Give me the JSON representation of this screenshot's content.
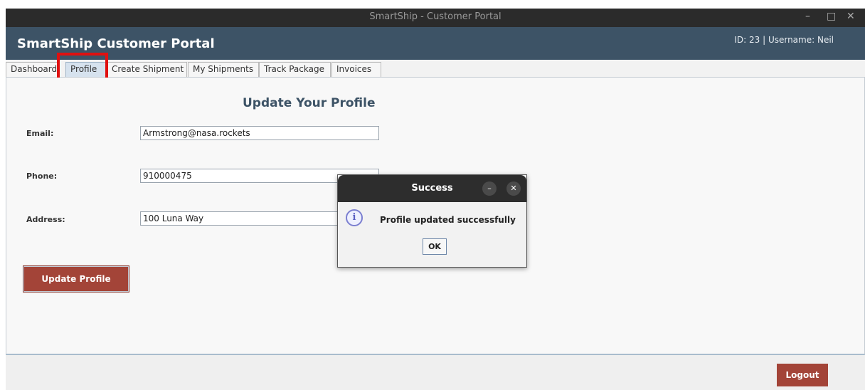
{
  "window": {
    "title": "SmartShip - Customer Portal",
    "minimize_glyph": "–",
    "maximize_glyph": "□",
    "close_glyph": "✕"
  },
  "header": {
    "app_title": "SmartShip Customer Portal",
    "user_info": "ID: 23 | Username: Neil"
  },
  "tabs": [
    {
      "label": "Dashboard"
    },
    {
      "label": "Profile"
    },
    {
      "label": "Create Shipment"
    },
    {
      "label": "My Shipments"
    },
    {
      "label": "Track Package"
    },
    {
      "label": "Invoices"
    }
  ],
  "active_tab": "Profile",
  "form": {
    "title": "Update Your Profile",
    "email_label": "Email:",
    "email_value": "Armstrong@nasa.rockets",
    "phone_label": "Phone:",
    "phone_value": "910000475",
    "address_label": "Address:",
    "address_value": "100 Luna Way",
    "update_button": "Update Profile"
  },
  "footer": {
    "logout_button": "Logout"
  },
  "dialog": {
    "title": "Success",
    "minimize_glyph": "–",
    "close_glyph": "✕",
    "info_glyph": "i",
    "message": "Profile updated successfully",
    "ok_button": "OK"
  },
  "colors": {
    "header_bg": "#3d5366",
    "accent_button": "#a34438",
    "highlight_box": "#e01010"
  },
  "icons": [
    "minimize-icon",
    "maximize-icon",
    "close-icon",
    "info-icon"
  ]
}
